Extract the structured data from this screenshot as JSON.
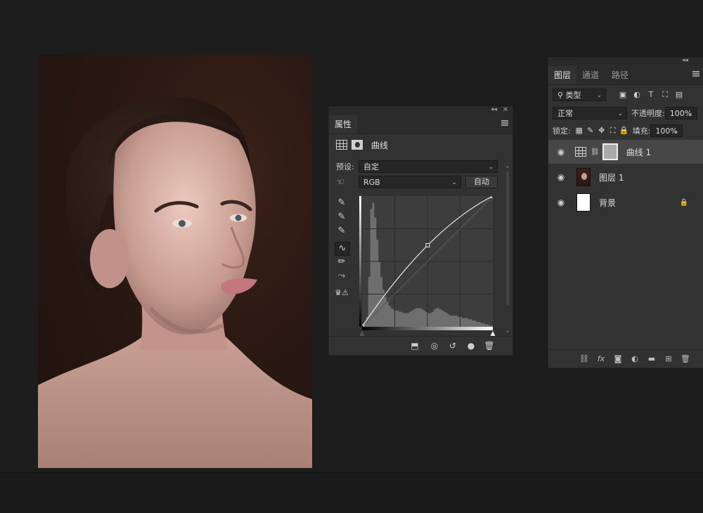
{
  "properties_panel": {
    "tab": "属性",
    "header_label": "曲线",
    "preset_label": "预设:",
    "preset_value": "自定",
    "channel_value": "RGB",
    "auto_button": "自动",
    "tools": [
      "sample-shadows-eyedropper-icon",
      "sample-midtones-eyedropper-icon",
      "sample-highlights-eyedropper-icon",
      "curve-points-icon",
      "pencil-icon",
      "smooth-icon",
      "clipping-warning-icon"
    ],
    "footer_icons": [
      "clip-to-layer-icon",
      "view-previous-icon",
      "reset-icon",
      "visibility-icon",
      "delete-icon"
    ]
  },
  "curve": {
    "points": [
      [
        0,
        0
      ],
      [
        128,
        159
      ],
      [
        255,
        255
      ]
    ],
    "histogram": [
      2,
      4,
      8,
      40,
      95,
      100,
      88,
      70,
      52,
      40,
      30,
      24,
      20,
      17,
      15,
      14,
      13,
      13,
      12,
      12,
      11,
      11,
      11,
      12,
      13,
      14,
      15,
      15,
      15,
      14,
      13,
      12,
      11,
      11,
      12,
      14,
      15,
      15,
      14,
      13,
      12,
      11,
      10,
      9,
      9,
      9,
      9,
      8,
      8,
      7,
      7,
      7,
      6,
      6,
      5,
      5,
      4,
      4,
      3,
      3,
      2,
      2,
      1,
      1
    ]
  },
  "layers_panel": {
    "tabs": [
      "图层",
      "通道",
      "路径"
    ],
    "filter_value": "类型",
    "blend_mode": "正常",
    "opacity_label": "不透明度:",
    "opacity_value": "100%",
    "lock_label": "锁定:",
    "fill_label": "填充:",
    "fill_value": "100%",
    "layers": [
      {
        "name": "曲线 1",
        "selected": true
      },
      {
        "name": "图层 1",
        "selected": false
      },
      {
        "name": "背景",
        "selected": false,
        "locked": true
      }
    ],
    "footer_icons": [
      "link-icon",
      "fx-icon",
      "mask-icon",
      "adjustment-icon",
      "folder-icon",
      "new-layer-icon",
      "trash-icon"
    ],
    "fx_label": "fx"
  }
}
